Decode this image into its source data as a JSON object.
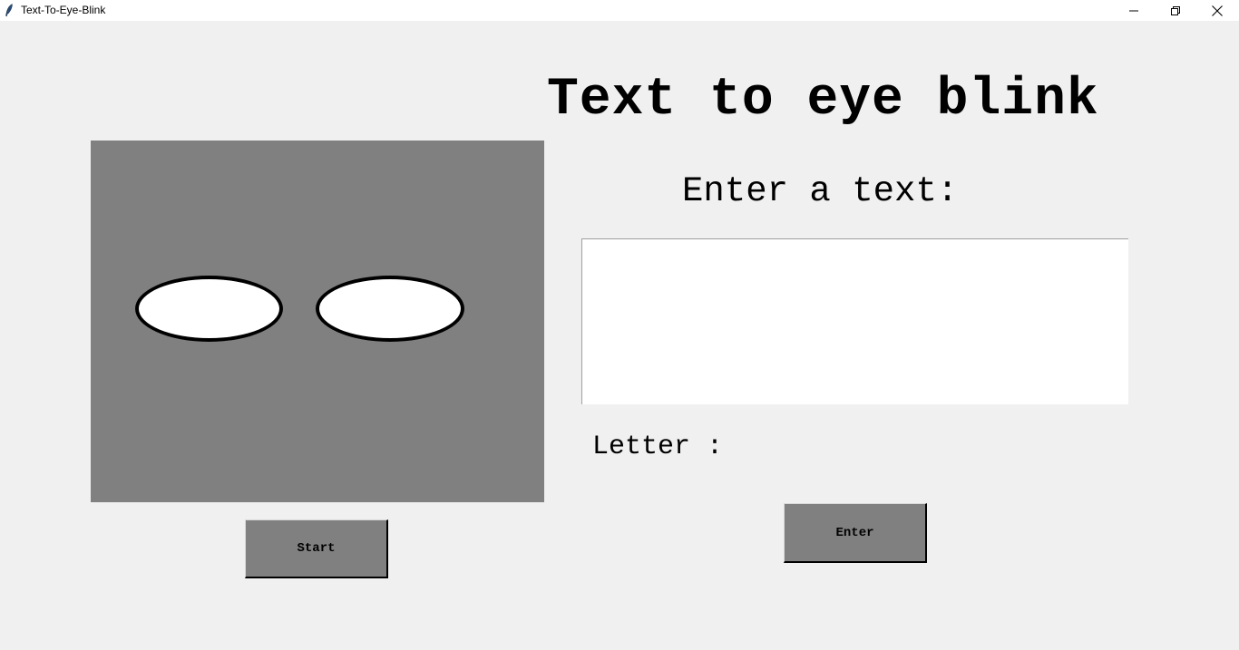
{
  "window": {
    "title": "Text-To-Eye-Blink",
    "app_icon": "feather-icon",
    "controls": {
      "minimize_icon": "minimize-icon",
      "maximize_icon": "restore-icon",
      "close_icon": "close-icon"
    }
  },
  "main": {
    "heading": "Text to eye blink",
    "prompt_label": "Enter a text:",
    "text_input": {
      "value": "",
      "placeholder": ""
    },
    "letter_label": "Letter :",
    "start_button": "Start",
    "enter_button": "Enter"
  },
  "colors": {
    "background": "#f0f0f0",
    "canvas": "#808080",
    "eye_fill": "#ffffff",
    "eye_outline": "#000000",
    "button": "#808080"
  }
}
